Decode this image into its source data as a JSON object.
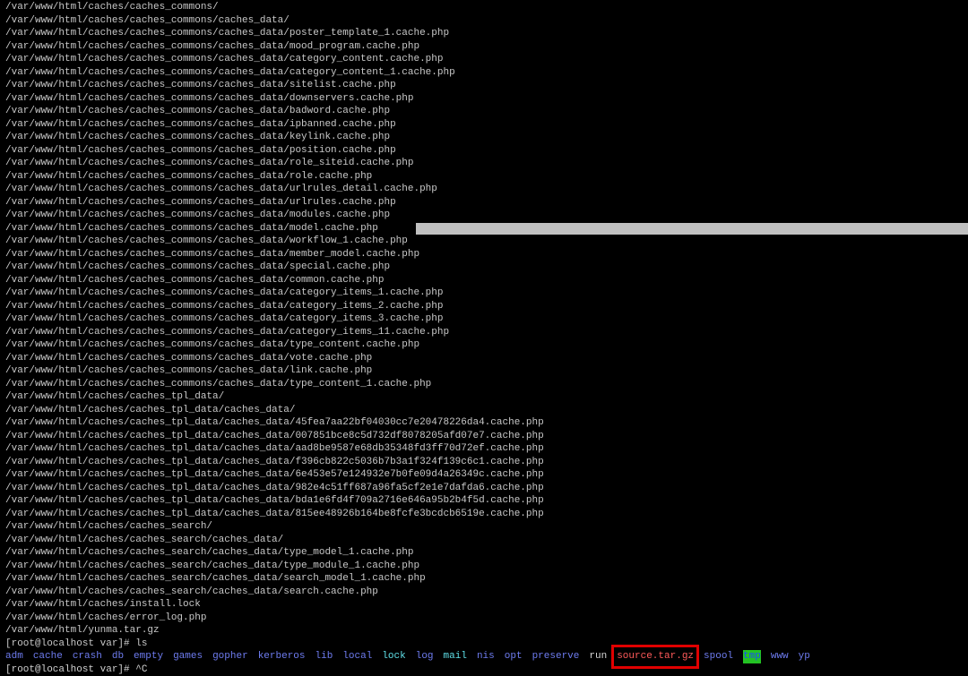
{
  "terminal": {
    "output_lines": [
      "/var/www/html/caches/caches_commons/",
      "/var/www/html/caches/caches_commons/caches_data/",
      "/var/www/html/caches/caches_commons/caches_data/poster_template_1.cache.php",
      "/var/www/html/caches/caches_commons/caches_data/mood_program.cache.php",
      "/var/www/html/caches/caches_commons/caches_data/category_content.cache.php",
      "/var/www/html/caches/caches_commons/caches_data/category_content_1.cache.php",
      "/var/www/html/caches/caches_commons/caches_data/sitelist.cache.php",
      "/var/www/html/caches/caches_commons/caches_data/downservers.cache.php",
      "/var/www/html/caches/caches_commons/caches_data/badword.cache.php",
      "/var/www/html/caches/caches_commons/caches_data/ipbanned.cache.php",
      "/var/www/html/caches/caches_commons/caches_data/keylink.cache.php",
      "/var/www/html/caches/caches_commons/caches_data/position.cache.php",
      "/var/www/html/caches/caches_commons/caches_data/role_siteid.cache.php",
      "/var/www/html/caches/caches_commons/caches_data/role.cache.php",
      "/var/www/html/caches/caches_commons/caches_data/urlrules_detail.cache.php",
      "/var/www/html/caches/caches_commons/caches_data/urlrules.cache.php",
      "/var/www/html/caches/caches_commons/caches_data/modules.cache.php",
      "/var/www/html/caches/caches_commons/caches_data/model.cache.php",
      "/var/www/html/caches/caches_commons/caches_data/workflow_1.cache.php",
      "/var/www/html/caches/caches_commons/caches_data/member_model.cache.php",
      "/var/www/html/caches/caches_commons/caches_data/special.cache.php",
      "/var/www/html/caches/caches_commons/caches_data/common.cache.php",
      "/var/www/html/caches/caches_commons/caches_data/category_items_1.cache.php",
      "/var/www/html/caches/caches_commons/caches_data/category_items_2.cache.php",
      "/var/www/html/caches/caches_commons/caches_data/category_items_3.cache.php",
      "/var/www/html/caches/caches_commons/caches_data/category_items_11.cache.php",
      "/var/www/html/caches/caches_commons/caches_data/type_content.cache.php",
      "/var/www/html/caches/caches_commons/caches_data/vote.cache.php",
      "/var/www/html/caches/caches_commons/caches_data/link.cache.php",
      "/var/www/html/caches/caches_commons/caches_data/type_content_1.cache.php",
      "/var/www/html/caches/caches_tpl_data/",
      "/var/www/html/caches/caches_tpl_data/caches_data/",
      "/var/www/html/caches/caches_tpl_data/caches_data/45fea7aa22bf04030cc7e20478226da4.cache.php",
      "/var/www/html/caches/caches_tpl_data/caches_data/007851bce8c5d732df8078205afd07e7.cache.php",
      "/var/www/html/caches/caches_tpl_data/caches_data/aad8be9587e68db35348fd3ff70d72ef.cache.php",
      "/var/www/html/caches/caches_tpl_data/caches_data/f396cb822c5036b7b3a1f324f139c6c1.cache.php",
      "/var/www/html/caches/caches_tpl_data/caches_data/6e453e57e124932e7b0fe09d4a26349c.cache.php",
      "/var/www/html/caches/caches_tpl_data/caches_data/982e4c51ff687a96fa5cf2e1e7dafda6.cache.php",
      "/var/www/html/caches/caches_tpl_data/caches_data/bda1e6fd4f709a2716e646a95b2b4f5d.cache.php",
      "/var/www/html/caches/caches_tpl_data/caches_data/815ee48926b164be8fcfe3bcdcb6519e.cache.php",
      "/var/www/html/caches/caches_search/",
      "/var/www/html/caches/caches_search/caches_data/",
      "/var/www/html/caches/caches_search/caches_data/type_model_1.cache.php",
      "/var/www/html/caches/caches_search/caches_data/type_module_1.cache.php",
      "/var/www/html/caches/caches_search/caches_data/search_model_1.cache.php",
      "/var/www/html/caches/caches_search/caches_data/search.cache.php",
      "/var/www/html/caches/install.lock",
      "/var/www/html/caches/error_log.php",
      "/var/www/html/yunma.tar.gz",
      "[root@localhost var]# ls"
    ],
    "highlighted_line_index": 17,
    "ls_items": [
      {
        "name": "adm",
        "kind": "dir"
      },
      {
        "name": "cache",
        "kind": "dir"
      },
      {
        "name": "crash",
        "kind": "dir"
      },
      {
        "name": "db",
        "kind": "dir"
      },
      {
        "name": "empty",
        "kind": "dir"
      },
      {
        "name": "games",
        "kind": "dir"
      },
      {
        "name": "gopher",
        "kind": "dir"
      },
      {
        "name": "kerberos",
        "kind": "dir"
      },
      {
        "name": "lib",
        "kind": "dir"
      },
      {
        "name": "local",
        "kind": "dir"
      },
      {
        "name": "lock",
        "kind": "cyan"
      },
      {
        "name": "log",
        "kind": "dir"
      },
      {
        "name": "mail",
        "kind": "cyan"
      },
      {
        "name": "nis",
        "kind": "dir"
      },
      {
        "name": "opt",
        "kind": "dir"
      },
      {
        "name": "preserve",
        "kind": "dir"
      },
      {
        "name": "run",
        "kind": "file"
      },
      {
        "name": "source.tar.gz",
        "kind": "red",
        "boxed": true
      },
      {
        "name": "spool",
        "kind": "dir"
      },
      {
        "name": "tmp",
        "kind": "green-bg"
      },
      {
        "name": "www",
        "kind": "dir"
      },
      {
        "name": "yp",
        "kind": "dir"
      }
    ],
    "last_prompt": "[root@localhost var]# ^C"
  },
  "colors": {
    "background": "#000000",
    "text": "#c8c8c8",
    "directory": "#6e7cf0",
    "symlink": "#5fe0e8",
    "archive": "#ff5a5a",
    "sticky_dir_bg": "#23c223",
    "annotation_box": "#e00000",
    "selection": "#c0c0c0"
  }
}
